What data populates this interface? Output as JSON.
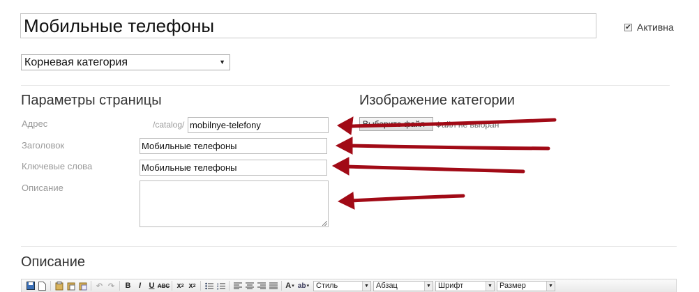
{
  "header": {
    "title_value": "Мобильные телефоны",
    "active_label": "Активна",
    "active_checked": true,
    "parent_category": "Корневая категория"
  },
  "page_params": {
    "heading": "Параметры страницы",
    "address_label": "Адрес",
    "address_prefix": "/catalog/",
    "address_value": "mobilnye-telefony",
    "title_label": "Заголовок",
    "title_value": "Мобильные телефоны",
    "keywords_label": "Ключевые слова",
    "keywords_value": "Мобильные телефоны",
    "description_label": "Описание",
    "description_value": ""
  },
  "image": {
    "heading": "Изображение категории",
    "button_label": "Выберите файл",
    "status": "Файл не выбран"
  },
  "description_section": {
    "heading": "Описание"
  },
  "toolbar": {
    "style_label": "Стиль",
    "format_label": "Абзац",
    "font_label": "Шрифт",
    "size_label": "Размер"
  },
  "colors": {
    "arrow": "#a10a16"
  }
}
